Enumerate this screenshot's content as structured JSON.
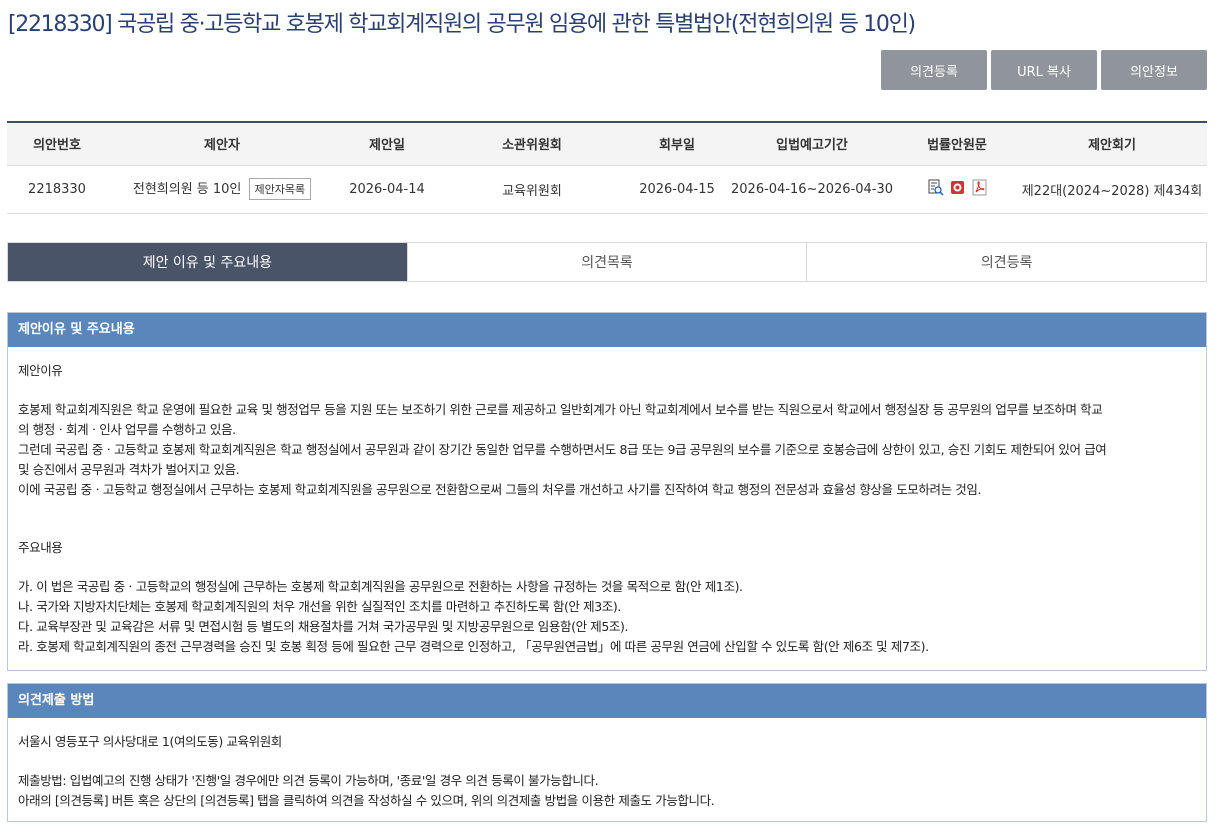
{
  "title": "[2218330] 국공립 중·고등학교 호봉제 학교회계직원의 공무원 임용에 관한 특별법안(전현희의원 등 10인)",
  "actions": {
    "opinion_register": "의견등록",
    "url_copy": "URL 복사",
    "bill_info": "의안정보"
  },
  "table": {
    "headers": [
      "의안번호",
      "제안자",
      "제안일",
      "소관위원회",
      "회부일",
      "입법예고기간",
      "법률안원문",
      "제안회기"
    ],
    "row": {
      "bill_no": "2218330",
      "proposer": "전현희의원 등 10인",
      "proposer_list_btn": "제안자목록",
      "propose_date": "2026-04-14",
      "committee": "교육위원회",
      "referral_date": "2026-04-15",
      "notice_period": "2026-04-16~2026-04-30",
      "session": "제22대(2024~2028) 제434회"
    },
    "law_icons": [
      "document-search-icon",
      "hwp-file-icon",
      "pdf-file-icon"
    ]
  },
  "tabs": [
    "제안 이유 및 주요내용",
    "의견목록",
    "의견등록"
  ],
  "reason_box": {
    "title": "제안이유 및 주요내용",
    "reason_heading": "제안이유",
    "reason_lines": [
      "호봉제 학교회계직원은 학교 운영에 필요한 교육 및 행정업무 등을 지원 또는 보조하기 위한 근로를 제공하고 일반회계가 아닌 학교회계에서 보수를 받는 직원으로서 학교에서 행정실장 등 공무원의 업무를 보조하며 학교",
      "의 행정ㆍ회계ㆍ인사 업무를 수행하고 있음.",
      "그런데 국공립 중ㆍ고등학교 호봉제 학교회계직원은 학교 행정실에서 공무원과 같이 장기간 동일한 업무를 수행하면서도 8급 또는 9급 공무원의 보수를 기준으로 호봉승급에 상한이 있고, 승진 기회도 제한되어 있어 급여",
      "및 승진에서 공무원과 격차가 벌어지고 있음.",
      "이에 국공립 중ㆍ고등학교 행정실에서 근무하는 호봉제 학교회계직원을 공무원으로 전환함으로써 그들의 처우를 개선하고 사기를 진작하여 학교 행정의 전문성과 효율성 향상을 도모하려는 것임."
    ],
    "main_heading": "주요내용",
    "main_lines": [
      "가. 이 법은 국공립 중ㆍ고등학교의 행정실에 근무하는 호봉제 학교회계직원을 공무원으로 전환하는 사항을 규정하는 것을 목적으로 함(안 제1조).",
      "나. 국가와 지방자치단체는 호봉제 학교회계직원의 처우 개선을 위한 실질적인 조치를 마련하고 추진하도록 함(안 제3조).",
      "다. 교육부장관 및 교육감은 서류 및 면접시험 등 별도의 채용절차를 거쳐 국가공무원 및 지방공무원으로 임용함(안 제5조).",
      "라. 호봉제 학교회계직원의 종전 근무경력을 승진 및 호봉 획정 등에 필요한 근무 경력으로 인정하고, 「공무원연금법」에 따른 공무원 연금에 산입할 수 있도록 함(안 제6조 및 제7조)."
    ]
  },
  "method_box": {
    "title": "의견제출 방법",
    "address": "서울시 영등포구 의사당대로 1(여의도동) 교육위원회",
    "lines": [
      "제출방법: 입법예고의 진행 상태가 '진행'일 경우에만 의견 등록이 가능하며, '종료'일 경우 의견 등록이 불가능합니다.",
      "아래의 [의견등록] 버튼 혹은 상단의 [의견등록] 탭을 클릭하여 의견을 작성하실 수 있으며, 위의 의견제출 방법을 이용한 제출도 가능합니다."
    ]
  }
}
